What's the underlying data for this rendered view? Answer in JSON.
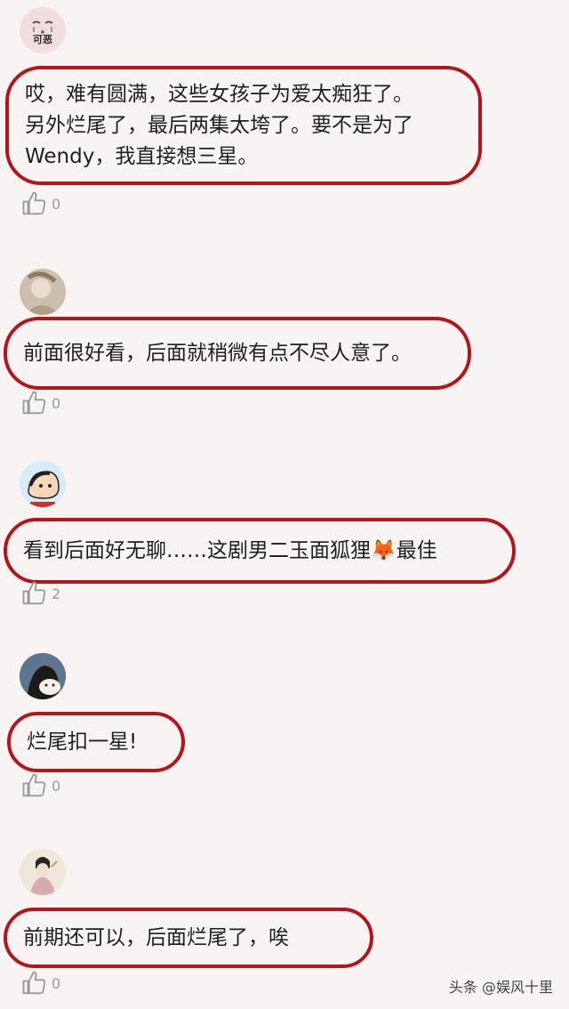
{
  "comments": [
    {
      "avatar_label": "可恶",
      "text": "哎，难有圆满，这些女孩子为爱太痴狂了。\n另外烂尾了，最后两集太垮了。要不是为了\nWendy，我直接想三星。",
      "likes": "0"
    },
    {
      "text": "前面很好看，后面就稍微有点不尽人意了。",
      "likes": "0"
    },
    {
      "text": "看到后面好无聊……这剧男二玉面狐狸🦊最佳",
      "likes": "2"
    },
    {
      "text": "烂尾扣一星!",
      "likes": "0"
    },
    {
      "text": "前期还可以，后面烂尾了，唉",
      "likes": "0"
    }
  ],
  "watermark": "头条 @娱风十里",
  "icons": {
    "like": "thumbs-up-icon"
  },
  "colors": {
    "highlight": "#b5141a",
    "background": "#f8f4f3"
  }
}
